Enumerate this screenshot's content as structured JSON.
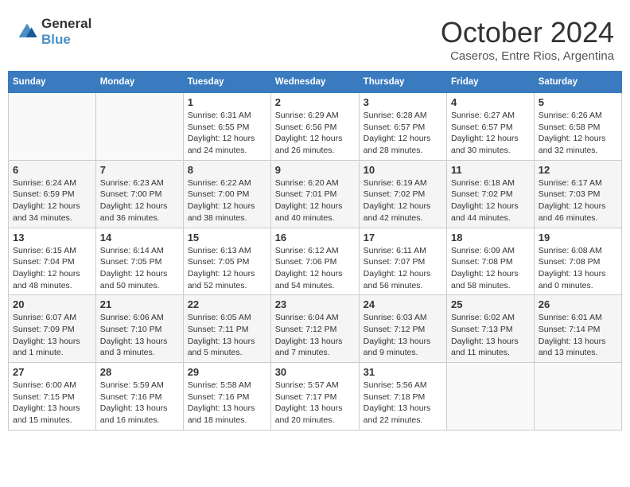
{
  "logo": {
    "line1": "General",
    "line2": "Blue"
  },
  "title": "October 2024",
  "subtitle": "Caseros, Entre Rios, Argentina",
  "days_of_week": [
    "Sunday",
    "Monday",
    "Tuesday",
    "Wednesday",
    "Thursday",
    "Friday",
    "Saturday"
  ],
  "weeks": [
    [
      {
        "day": "",
        "info": ""
      },
      {
        "day": "",
        "info": ""
      },
      {
        "day": "1",
        "info": "Sunrise: 6:31 AM\nSunset: 6:55 PM\nDaylight: 12 hours and 24 minutes."
      },
      {
        "day": "2",
        "info": "Sunrise: 6:29 AM\nSunset: 6:56 PM\nDaylight: 12 hours and 26 minutes."
      },
      {
        "day": "3",
        "info": "Sunrise: 6:28 AM\nSunset: 6:57 PM\nDaylight: 12 hours and 28 minutes."
      },
      {
        "day": "4",
        "info": "Sunrise: 6:27 AM\nSunset: 6:57 PM\nDaylight: 12 hours and 30 minutes."
      },
      {
        "day": "5",
        "info": "Sunrise: 6:26 AM\nSunset: 6:58 PM\nDaylight: 12 hours and 32 minutes."
      }
    ],
    [
      {
        "day": "6",
        "info": "Sunrise: 6:24 AM\nSunset: 6:59 PM\nDaylight: 12 hours and 34 minutes."
      },
      {
        "day": "7",
        "info": "Sunrise: 6:23 AM\nSunset: 7:00 PM\nDaylight: 12 hours and 36 minutes."
      },
      {
        "day": "8",
        "info": "Sunrise: 6:22 AM\nSunset: 7:00 PM\nDaylight: 12 hours and 38 minutes."
      },
      {
        "day": "9",
        "info": "Sunrise: 6:20 AM\nSunset: 7:01 PM\nDaylight: 12 hours and 40 minutes."
      },
      {
        "day": "10",
        "info": "Sunrise: 6:19 AM\nSunset: 7:02 PM\nDaylight: 12 hours and 42 minutes."
      },
      {
        "day": "11",
        "info": "Sunrise: 6:18 AM\nSunset: 7:02 PM\nDaylight: 12 hours and 44 minutes."
      },
      {
        "day": "12",
        "info": "Sunrise: 6:17 AM\nSunset: 7:03 PM\nDaylight: 12 hours and 46 minutes."
      }
    ],
    [
      {
        "day": "13",
        "info": "Sunrise: 6:15 AM\nSunset: 7:04 PM\nDaylight: 12 hours and 48 minutes."
      },
      {
        "day": "14",
        "info": "Sunrise: 6:14 AM\nSunset: 7:05 PM\nDaylight: 12 hours and 50 minutes."
      },
      {
        "day": "15",
        "info": "Sunrise: 6:13 AM\nSunset: 7:05 PM\nDaylight: 12 hours and 52 minutes."
      },
      {
        "day": "16",
        "info": "Sunrise: 6:12 AM\nSunset: 7:06 PM\nDaylight: 12 hours and 54 minutes."
      },
      {
        "day": "17",
        "info": "Sunrise: 6:11 AM\nSunset: 7:07 PM\nDaylight: 12 hours and 56 minutes."
      },
      {
        "day": "18",
        "info": "Sunrise: 6:09 AM\nSunset: 7:08 PM\nDaylight: 12 hours and 58 minutes."
      },
      {
        "day": "19",
        "info": "Sunrise: 6:08 AM\nSunset: 7:08 PM\nDaylight: 13 hours and 0 minutes."
      }
    ],
    [
      {
        "day": "20",
        "info": "Sunrise: 6:07 AM\nSunset: 7:09 PM\nDaylight: 13 hours and 1 minute."
      },
      {
        "day": "21",
        "info": "Sunrise: 6:06 AM\nSunset: 7:10 PM\nDaylight: 13 hours and 3 minutes."
      },
      {
        "day": "22",
        "info": "Sunrise: 6:05 AM\nSunset: 7:11 PM\nDaylight: 13 hours and 5 minutes."
      },
      {
        "day": "23",
        "info": "Sunrise: 6:04 AM\nSunset: 7:12 PM\nDaylight: 13 hours and 7 minutes."
      },
      {
        "day": "24",
        "info": "Sunrise: 6:03 AM\nSunset: 7:12 PM\nDaylight: 13 hours and 9 minutes."
      },
      {
        "day": "25",
        "info": "Sunrise: 6:02 AM\nSunset: 7:13 PM\nDaylight: 13 hours and 11 minutes."
      },
      {
        "day": "26",
        "info": "Sunrise: 6:01 AM\nSunset: 7:14 PM\nDaylight: 13 hours and 13 minutes."
      }
    ],
    [
      {
        "day": "27",
        "info": "Sunrise: 6:00 AM\nSunset: 7:15 PM\nDaylight: 13 hours and 15 minutes."
      },
      {
        "day": "28",
        "info": "Sunrise: 5:59 AM\nSunset: 7:16 PM\nDaylight: 13 hours and 16 minutes."
      },
      {
        "day": "29",
        "info": "Sunrise: 5:58 AM\nSunset: 7:16 PM\nDaylight: 13 hours and 18 minutes."
      },
      {
        "day": "30",
        "info": "Sunrise: 5:57 AM\nSunset: 7:17 PM\nDaylight: 13 hours and 20 minutes."
      },
      {
        "day": "31",
        "info": "Sunrise: 5:56 AM\nSunset: 7:18 PM\nDaylight: 13 hours and 22 minutes."
      },
      {
        "day": "",
        "info": ""
      },
      {
        "day": "",
        "info": ""
      }
    ]
  ]
}
